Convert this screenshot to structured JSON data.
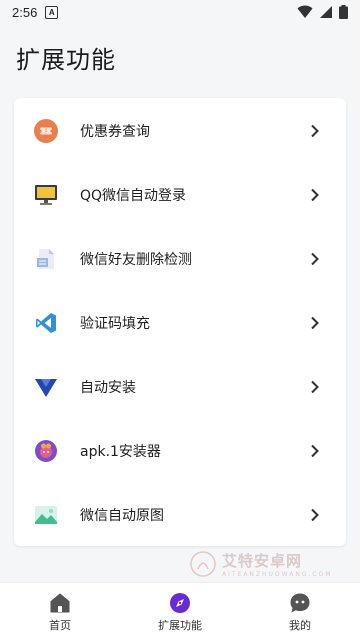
{
  "status_bar": {
    "time": "2:56",
    "notif_glyph": "A"
  },
  "page_title": "扩展功能",
  "items": [
    {
      "label": "优惠券查询",
      "icon": "ticket-icon",
      "color": "#e8804e"
    },
    {
      "label": "QQ微信自动登录",
      "icon": "monitor-icon",
      "color": "#f2c23a"
    },
    {
      "label": "微信好友删除检测",
      "icon": "document-icon",
      "color": "#9fb7d9"
    },
    {
      "label": "验证码填充",
      "icon": "vscode-icon",
      "color": "#2f8fe0"
    },
    {
      "label": "自动安装",
      "icon": "triangle-install-icon",
      "color": "#2447b3"
    },
    {
      "label": "apk.1安装器",
      "icon": "apk-installer-icon",
      "color": "#7b4fc9"
    },
    {
      "label": "微信自动原图",
      "icon": "image-icon",
      "color": "#3dbf8f"
    }
  ],
  "watermark": {
    "text": "艾特安卓网",
    "sub": "AITEANZHUOWANG.COM"
  },
  "bottom_nav": [
    {
      "label": "首页",
      "icon": "home-icon",
      "active": false
    },
    {
      "label": "扩展功能",
      "icon": "compass-icon",
      "active": true
    },
    {
      "label": "我的",
      "icon": "chat-face-icon",
      "active": false
    }
  ],
  "colors": {
    "accent": "#6a2bd6",
    "background": "#f5f6f8",
    "card": "#ffffff"
  }
}
